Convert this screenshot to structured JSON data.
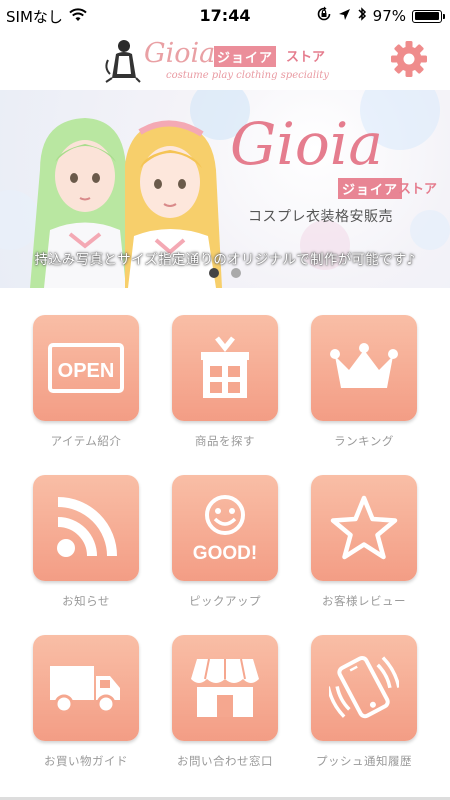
{
  "status_bar": {
    "carrier": "SIMなし",
    "time": "17:44",
    "battery": "97%",
    "battery_level": 0.97
  },
  "header": {
    "logo_script": "Gioia",
    "logo_kana": "ジョイア",
    "logo_store": "ストア",
    "logo_subtitle": "costume play clothing speciality"
  },
  "banner": {
    "logo_script": "Gioia",
    "logo_kana": "ジョイア",
    "logo_store": "ストア",
    "subtitle": "コスプレ衣装格安販売",
    "caption": "持込み写真とサイズ指定通りのオリジナルで制作が可能です♪",
    "active_slide": 1,
    "slide_count": 2
  },
  "menu": [
    {
      "label": "アイテム紹介",
      "icon": "open-sign-icon",
      "badge_text": "OPEN"
    },
    {
      "label": "商品を探す",
      "icon": "gift-box-icon"
    },
    {
      "label": "ランキング",
      "icon": "crown-icon"
    },
    {
      "label": "お知らせ",
      "icon": "rss-icon"
    },
    {
      "label": "ピックアップ",
      "icon": "good-smiley-icon",
      "badge_text": "GOOD!"
    },
    {
      "label": "お客様レビュー",
      "icon": "star-icon"
    },
    {
      "label": "お買い物ガイド",
      "icon": "truck-icon"
    },
    {
      "label": "お問い合わせ窓口",
      "icon": "storefront-icon"
    },
    {
      "label": "プッシュ通知履歴",
      "icon": "vibrating-phone-icon"
    }
  ],
  "colors": {
    "tile_top": "#f9bea6",
    "tile_bottom": "#f39d85",
    "brand_pink": "#e57d8e",
    "label_gray": "#9a9a9a"
  }
}
